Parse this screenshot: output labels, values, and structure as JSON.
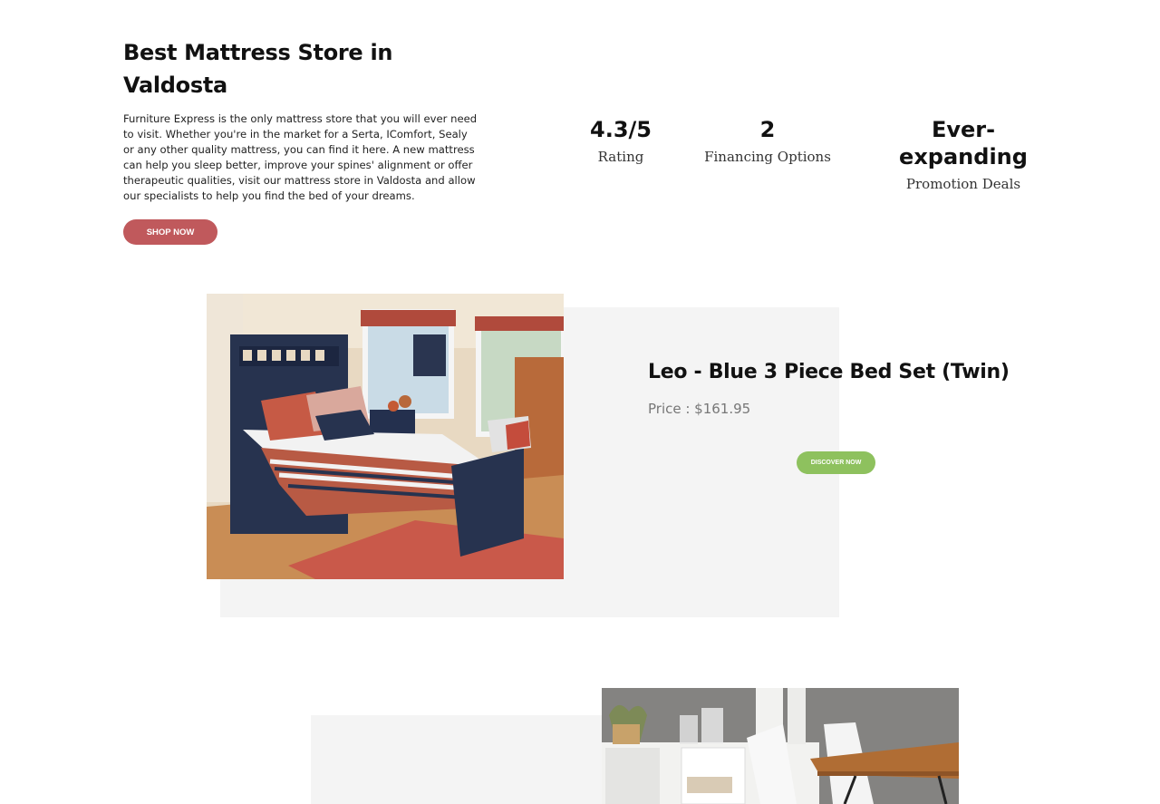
{
  "hero": {
    "title": "Best Mattress Store in Valdosta",
    "description": "Furniture Express is the only mattress store that you will ever need to visit. Whether you're in the market for a Serta, IComfort, Sealy or any other quality mattress, you can find it here. A new mattress can help you sleep better, improve your spines' alignment or offer therapeutic qualities, visit our mattress store in Valdosta and allow our specialists to help you find the bed of your dreams.",
    "cta_label": "SHOP NOW"
  },
  "stats": [
    {
      "value": "4.3/5",
      "label": "Rating"
    },
    {
      "value": "2",
      "label": "Financing Options"
    },
    {
      "value": "Ever-expanding",
      "label": "Promotion Deals"
    }
  ],
  "products": [
    {
      "title": "Leo - Blue 3 Piece Bed Set (Twin)",
      "price": "Price : $161.95",
      "cta_label": "DISCOVER NOW"
    }
  ],
  "colors": {
    "shop_button": "#c0595c",
    "discover_button": "#8ec15e",
    "panel_bg": "#f4f4f4"
  }
}
